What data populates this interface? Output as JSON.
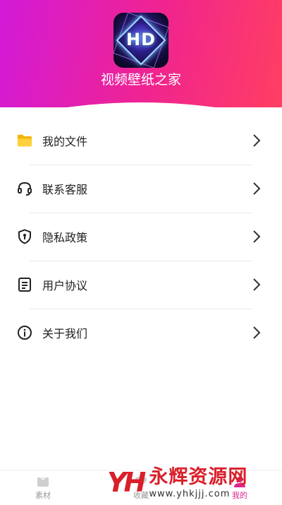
{
  "app": {
    "title": "视频壁纸之家",
    "icon_text": "HD"
  },
  "colors": {
    "gradient_start": "#d21ad8",
    "gradient_end": "#ff3f62",
    "accent": "#e0238f"
  },
  "menu": [
    {
      "label": "我的文件",
      "icon": "folder-icon"
    },
    {
      "label": "联系客服",
      "icon": "headset-icon"
    },
    {
      "label": "隐私政策",
      "icon": "shield-icon"
    },
    {
      "label": "用户协议",
      "icon": "document-icon"
    },
    {
      "label": "关于我们",
      "icon": "info-icon"
    }
  ],
  "tabbar": {
    "tabs": [
      {
        "label": "素材",
        "icon": "material-icon",
        "active": false
      },
      {
        "label": "收藏",
        "icon": "heart-icon",
        "active": false
      },
      {
        "label": "我的",
        "icon": "profile-icon",
        "active": true
      }
    ]
  },
  "watermark": {
    "logo": "YH",
    "title": "永辉资源网",
    "url": "www.yhkjjj.com"
  }
}
